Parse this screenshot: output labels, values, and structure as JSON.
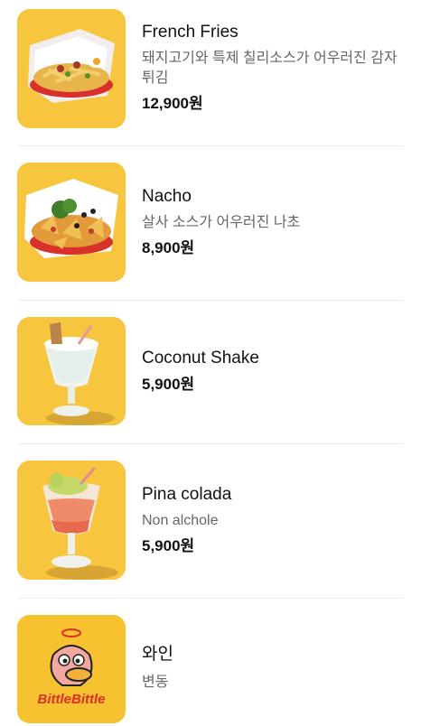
{
  "menu": {
    "items": [
      {
        "name": "French Fries",
        "description": "돼지고기와 특제 칠리소스가 어우러진 감자튀김",
        "price": "12,900원",
        "image_icon": "fries-basket-photo"
      },
      {
        "name": "Nacho",
        "description": "살사 소스가 어우러진 나초",
        "price": "8,900원",
        "image_icon": "nacho-basket-photo"
      },
      {
        "name": "Coconut Shake",
        "description": "",
        "price": "5,900원",
        "image_icon": "coconut-shake-photo"
      },
      {
        "name": "Pina colada",
        "description": "Non alchole",
        "price": "5,900원",
        "image_icon": "pina-colada-photo"
      },
      {
        "name": "와인",
        "description": "변동",
        "price": "",
        "image_icon": "bittle-bittle-logo",
        "logo_text": "BittleBittle"
      }
    ]
  },
  "colors": {
    "thumb_background": "#f7c53e",
    "divider": "#ececec",
    "logo_red": "#d8302a"
  }
}
